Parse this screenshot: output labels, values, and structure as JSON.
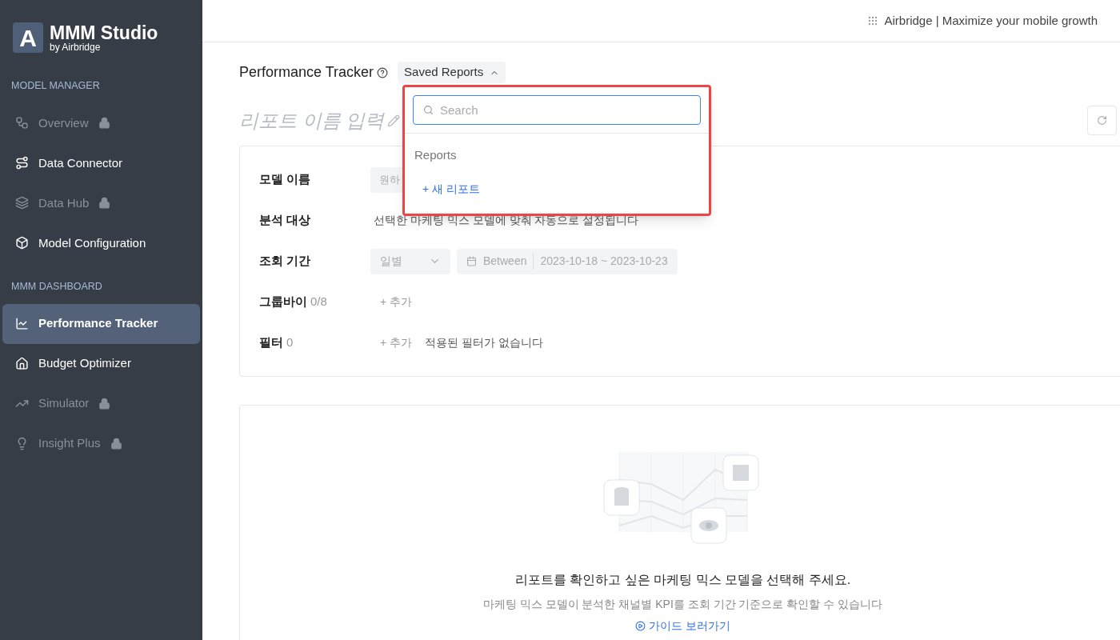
{
  "brand": {
    "mark": "A",
    "name": "MMM Studio",
    "byline": "by Airbridge"
  },
  "sidebar": {
    "sections": [
      {
        "title": "MODEL MANAGER",
        "items": [
          {
            "label": "Overview",
            "locked": true,
            "selected": false
          },
          {
            "label": "Data Connector",
            "locked": false,
            "selected": false
          },
          {
            "label": "Data Hub",
            "locked": true,
            "selected": false
          },
          {
            "label": "Model Configuration",
            "locked": false,
            "selected": false
          }
        ]
      },
      {
        "title": "MMM DASHBOARD",
        "items": [
          {
            "label": "Performance Tracker",
            "locked": false,
            "selected": true
          },
          {
            "label": "Budget Optimizer",
            "locked": false,
            "selected": false
          },
          {
            "label": "Simulator",
            "locked": true,
            "selected": false
          },
          {
            "label": "Insight Plus",
            "locked": true,
            "selected": false
          }
        ]
      }
    ]
  },
  "topbar": {
    "text": "Airbridge | Maximize your mobile growth"
  },
  "page": {
    "title": "Performance Tracker",
    "saved_reports": {
      "label": "Saved Reports",
      "expanded": true
    },
    "report_name_placeholder": "리포트 이름 입력"
  },
  "dropdown": {
    "search_placeholder": "Search",
    "section": "Reports",
    "new_item": "+ 새 리포트"
  },
  "form": {
    "rows": [
      {
        "kind": "select",
        "label": "모델 이름",
        "value": "원하"
      },
      {
        "kind": "text",
        "label": "분석 대상",
        "value": "선택한 마케팅 믹스 모델에 맞춰 자동으로 설정됩니다"
      },
      {
        "kind": "period",
        "label": "조회 기간",
        "unit": "일별",
        "range_label": "Between",
        "start": "2023-10-18",
        "sep": "~",
        "end": "2023-10-23"
      },
      {
        "kind": "add",
        "label": "그룹바이",
        "count": "0/8",
        "add": "+ 추가"
      },
      {
        "kind": "add",
        "label": "필터",
        "count": "0",
        "add": "+ 추가",
        "note": "적용된 필터가 없습니다"
      }
    ]
  },
  "empty_state": {
    "title": "리포트를 확인하고 싶은 마케팅 믹스 모델을 선택해 주세요.",
    "subtitle": "마케팅 믹스 모델이 분석한 채널별 KPI를 조회 기간 기준으로 확인할 수 있습니다",
    "link": "가이드 보러가기"
  }
}
